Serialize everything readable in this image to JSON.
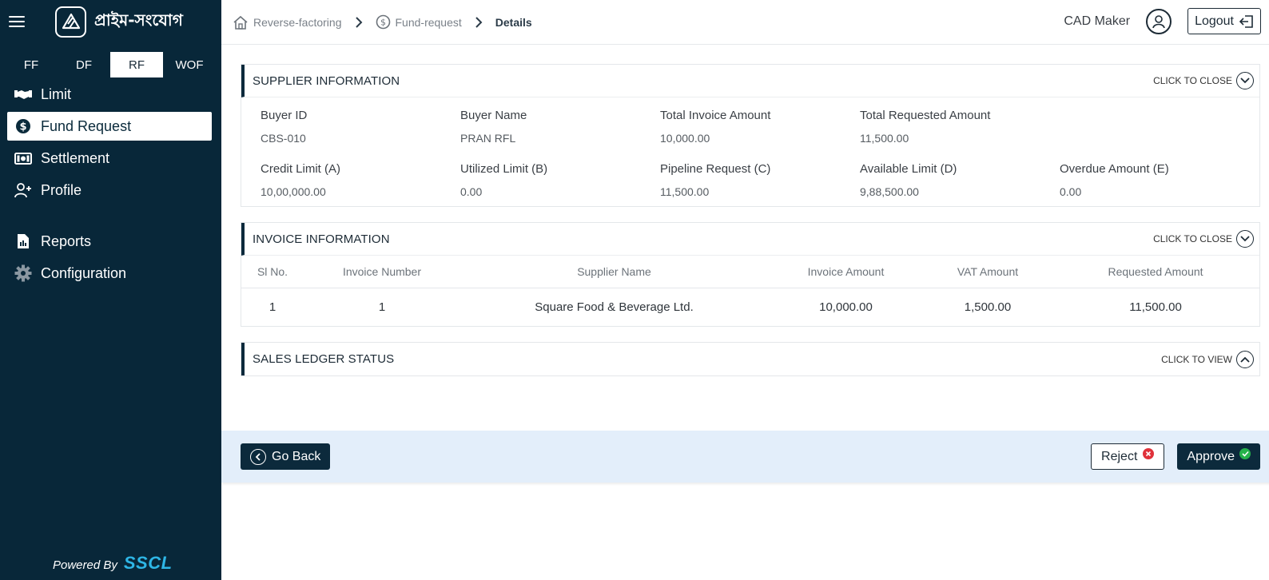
{
  "sidebar": {
    "brand": "প্রাইম-সংযোগ",
    "product_tabs": [
      {
        "label": "FF",
        "active": false
      },
      {
        "label": "DF",
        "active": false
      },
      {
        "label": "RF",
        "active": true
      },
      {
        "label": "WOF",
        "active": false
      }
    ],
    "menu": [
      {
        "label": "Limit",
        "icon": "handshake-icon"
      },
      {
        "label": "Fund Request",
        "icon": "dollar-circle-icon",
        "active": true
      },
      {
        "label": "Settlement",
        "icon": "banknote-icon"
      },
      {
        "label": "Profile",
        "icon": "user-plus-icon"
      }
    ],
    "menu2": [
      {
        "label": "Reports",
        "icon": "report-file-icon"
      },
      {
        "label": "Configuration",
        "icon": "gear-icon"
      }
    ],
    "powered_by": "Powered By",
    "powered_brand": "SSCL"
  },
  "header": {
    "breadcrumb": [
      {
        "label": "Reverse-factoring",
        "icon": "home-icon"
      },
      {
        "label": "Fund-request",
        "icon": "dollar-circle-icon"
      },
      {
        "label": "Details"
      }
    ],
    "username": "CAD Maker",
    "logout_label": "Logout"
  },
  "supplier": {
    "title": "SUPPLIER INFORMATION",
    "toggle": "CLICK TO CLOSE",
    "fields": [
      {
        "label": "Buyer ID",
        "value": "CBS-010"
      },
      {
        "label": "Buyer Name",
        "value": "PRAN RFL"
      },
      {
        "label": "Total Invoice Amount",
        "value": "10,000.00"
      },
      {
        "label": "Total Requested Amount",
        "value": "11,500.00"
      },
      {
        "label": "",
        "value": ""
      },
      {
        "label": "Credit Limit (A)",
        "value": "10,00,000.00"
      },
      {
        "label": "Utilized Limit (B)",
        "value": "0.00"
      },
      {
        "label": "Pipeline Request (C)",
        "value": "11,500.00"
      },
      {
        "label": "Available Limit (D)",
        "value": "9,88,500.00"
      },
      {
        "label": "Overdue Amount (E)",
        "value": "0.00"
      }
    ]
  },
  "invoice": {
    "title": "INVOICE INFORMATION",
    "toggle": "CLICK TO CLOSE",
    "columns": [
      "Sl No.",
      "Invoice Number",
      "Supplier Name",
      "Invoice Amount",
      "VAT Amount",
      "Requested Amount"
    ],
    "rows": [
      [
        "1",
        "1",
        "Square Food & Beverage Ltd.",
        "10,000.00",
        "1,500.00",
        "11,500.00"
      ]
    ]
  },
  "sales": {
    "title": "SALES LEDGER STATUS",
    "toggle": "CLICK TO VIEW"
  },
  "actions": {
    "back": "Go Back",
    "reject": "Reject",
    "approve": "Approve"
  }
}
